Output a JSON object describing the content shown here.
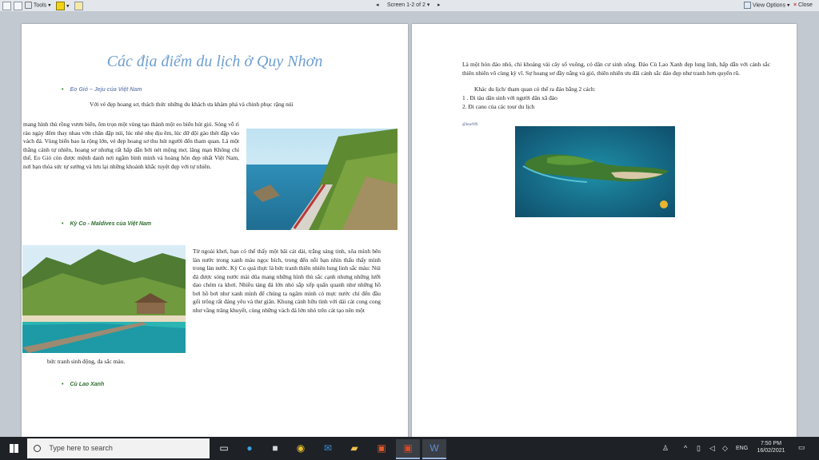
{
  "toolbar": {
    "tools_label": "Tools",
    "screen_label": "Screen 1-2 of 2",
    "view_options_label": "View Options",
    "close_label": "Close"
  },
  "page1": {
    "title": "Các địa điểm du lịch ở Quy Nhơn",
    "bullet1": "Eo Gió – Jeju của Việt Nam",
    "para1_first": "Với vẻ đẹp hoang sơ, thách thức những du khách ưa khám phá và chinh phục rặng núi",
    "para1_rest": "mang hình thù rồng vươn biển, ôm trọn một vùng tạo thành một eo biển hút gió. Sóng vỗ rì rào ngày đêm thay nhau vờn chân đập núi, lúc nhè nhẹ dịu êm, lúc dữ dội gào thét đập vào vách đá. Vùng biển bao la rộng lớn, vẻ đẹp hoang sơ thu hút người đến tham quan. Là một thắng cảnh tự nhiên, hoang sơ nhưng rất hấp dẫn bởi nét mộng mơ, lãng mạn Không chỉ thế, Eo Gió còn được mệnh danh nơi ngắm bình minh và hoàng hôn đẹp nhất Việt Nam, nơi bạn thỏa sức tự sướng và lưu lại những khoảnh khắc tuyệt đẹp với tự nhiên.",
    "bullet2": "Kỳ Co - Maldives của Việt Nam",
    "para2": "Từ ngoài khơi, bạn có thể thấy một bãi cát dài, trắng sáng tinh, xõa mình bên làn nước trong xanh màu ngọc bích, trong đến nỗi bạn nhìn thấu thấy mình trong làn nước. Kỳ Co quả thực là bức tranh thiên nhiên lung linh sắc màu: Núi đá được sóng nước mài dũa mang những hình thù sắc cạnh nhưng những lưỡi dao chém ra khơi. Nhiều tảng đá lớn nhỏ sắp xếp quấn quanh như những hồ bơi hồ bơi như xanh mình để chúng ta ngâm mình có mực nước chỉ đến đầu gối trông rất đáng yêu và thư giãn. Khung cảnh hữu tình với dải cát cong cong như vầng trăng khuyết, cùng những vách đá lớn nhỏ trên cát tạo nên một",
    "para2_tail": "bức tranh sinh động, đa sắc màu.",
    "bullet3": "Cù Lao Xanh"
  },
  "page2": {
    "para1": "Là một hòn đảo nhỏ, chỉ khoảng vài cây số vuông, có dân cư sinh sống. Đảo Cù Lao Xanh đẹp lung linh, hấp dẫn với cảnh sắc thiên nhiên vô cùng kỳ vĩ. Sự hoang sơ đầy nắng và gió, thiên nhiên ưu đãi cảnh sắc đảo đẹp như tranh hơn quyến rũ.",
    "line2": "Khác du lịch/ tham quan có thể ra đảo bằng 2 cách:",
    "line3": "1 . Đi tàu dân sinh với người dân xã đảo",
    "line4": "2. Đi cano của các tour du lịch",
    "credit": "@lowNN"
  },
  "taskbar": {
    "search_placeholder": "Type here to search",
    "time": "7:50 PM",
    "date": "16/02/2021",
    "lang": "ENG"
  },
  "colors": {
    "title": "#6f9fd0",
    "bullet_blue": "#7b8fb8",
    "bullet_green": "#2f6e2f"
  }
}
